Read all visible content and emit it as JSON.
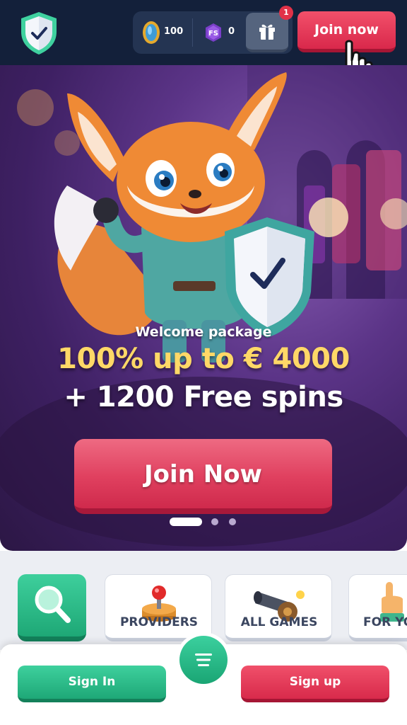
{
  "header": {
    "coins_value": "100",
    "free_spins_value": "0",
    "fs_icon_text": "FS",
    "gift_badge": "1",
    "join_label": "Join now"
  },
  "banner": {
    "subtitle": "Welcome package",
    "offer_line1": "100% up to € 4000",
    "offer_line2": "+ 1200 Free spins",
    "cta_label": "Join Now",
    "slide_count": 3,
    "active_slide": 1
  },
  "categories": [
    {
      "label": "PROVIDERS",
      "icon": "joystick-icon"
    },
    {
      "label": "ALL GAMES",
      "icon": "cannon-icon"
    },
    {
      "label": "FOR YO",
      "icon": "pointing-hand-icon"
    }
  ],
  "bottom_bar": {
    "sign_in_label": "Sign In",
    "sign_up_label": "Sign up"
  },
  "colors": {
    "header_bg": "#13203a",
    "primary_red": "#e0405f",
    "primary_green": "#1ea876",
    "offer_yellow": "#ffd867",
    "banner_purple": "#4a2672"
  }
}
